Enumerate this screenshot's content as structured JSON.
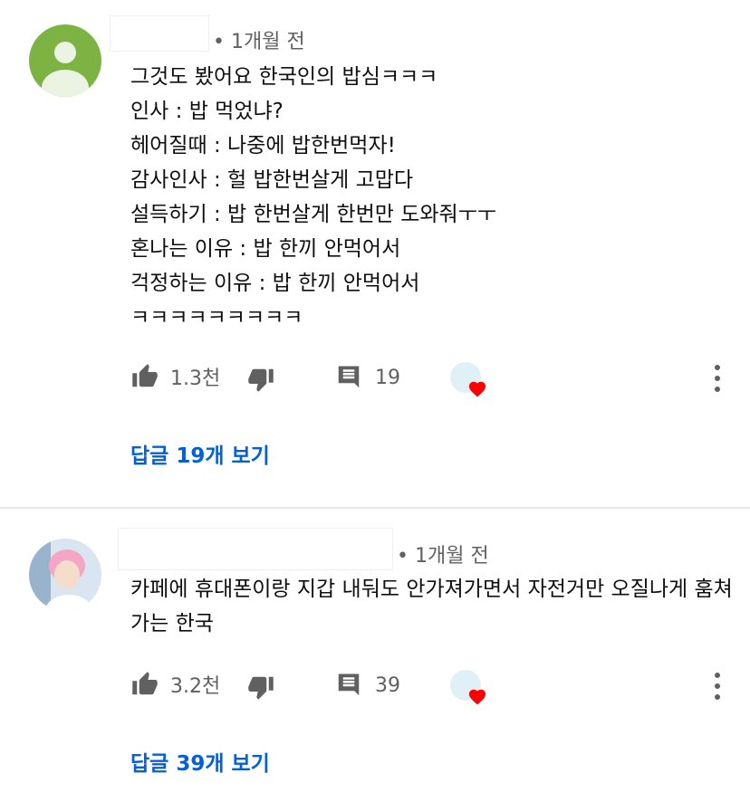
{
  "comments": [
    {
      "time": "• 1개월 전",
      "lines": [
        "그것도 봤어요 한국인의 밥심ㅋㅋㅋ",
        "인사 : 밥 먹었냐?",
        "헤어질때 : 나중에 밥한번먹자!",
        "감사인사 : 헐 밥한번살게 고맙다",
        "설득하기 : 밥 한번살게 한번만 도와줘ㅜㅜ",
        "혼나는 이유 : 밥 한끼 안먹어서",
        "걱정하는 이유 : 밥 한끼 안먹어서",
        "ㅋㅋㅋㅋㅋㅋㅋㅋㅋ"
      ],
      "likes": "1.3천",
      "reply_count": "19",
      "replies_label": "답글 19개 보기",
      "avatar_color": "#7cb342"
    },
    {
      "time": "• 1개월 전",
      "lines": [
        "카페에 휴대폰이랑 지갑 내둬도 안가져가면서 자전거만 오질나게 훔쳐",
        "가는 한국"
      ],
      "likes": "3.2천",
      "reply_count": "39",
      "replies_label": "답글 39개 보기"
    }
  ],
  "icons": {
    "like": "thumbs-up-icon",
    "dislike": "thumbs-down-icon",
    "reply": "comment-icon",
    "heart": "creator-heart-icon",
    "more": "more-vertical-icon"
  },
  "colors": {
    "link": "#065fd4",
    "meta": "#606060",
    "heart": "#ff0000"
  }
}
